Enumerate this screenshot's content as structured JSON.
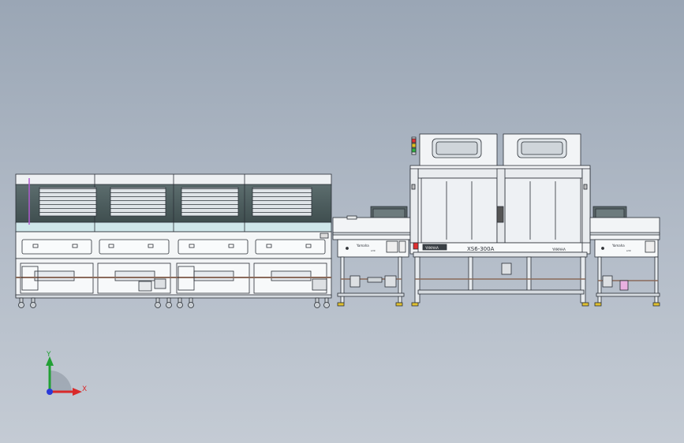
{
  "drawing": {
    "model_label": "XS6-300A",
    "conveyor_brand_label": "Yamaha",
    "conveyor_sub_label": "smt",
    "brand_plate_label": "YAMAHA",
    "machine_brand_label": "YAMAHA"
  },
  "triad": {
    "x_label": "X",
    "y_label": "Y"
  },
  "colors": {
    "background_top": "#9aa6b5",
    "background_bottom": "#c4cbd4",
    "machine_body": "#f2f4f6",
    "outline": "#2a2f36",
    "glass": "#4a5a5c",
    "conveyor_belt": "#8a6a5a",
    "x_axis": "#d92a2a",
    "y_axis": "#22a035",
    "z_axis": "#2a3ad9"
  }
}
